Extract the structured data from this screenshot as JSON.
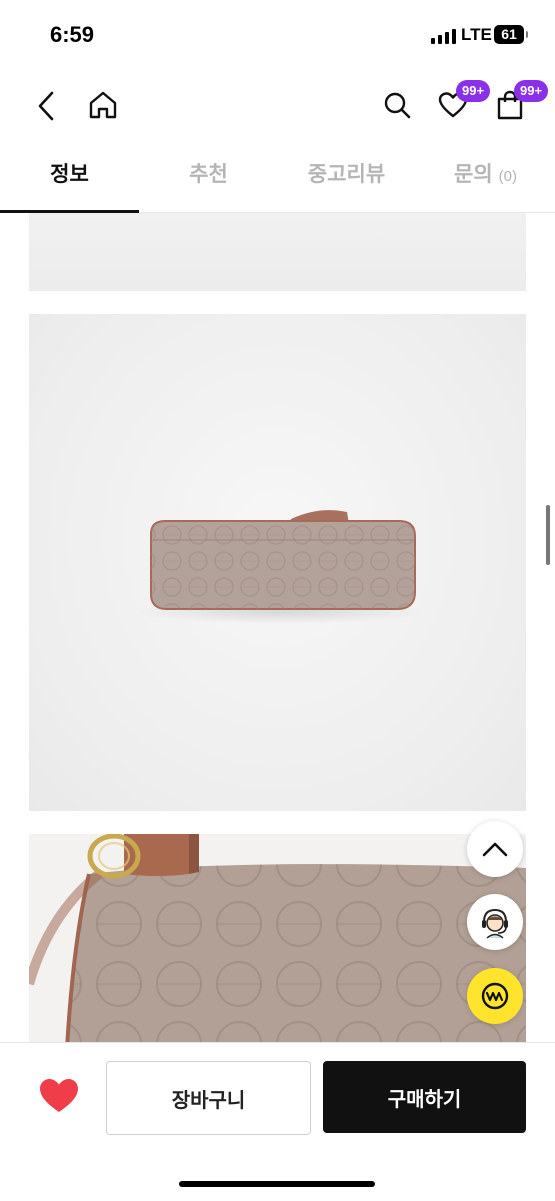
{
  "status_bar": {
    "time": "6:59",
    "network": "LTE",
    "battery": "61"
  },
  "header": {
    "wishlist_badge": "99+",
    "cart_badge": "99+"
  },
  "tabs": [
    {
      "label": "정보",
      "active": true
    },
    {
      "label": "추천",
      "active": false
    },
    {
      "label": "중고리뷰",
      "active": false
    },
    {
      "label": "문의",
      "count": "(0)",
      "active": false
    }
  ],
  "bottom_bar": {
    "cart_label": "장바구니",
    "buy_label": "구매하기"
  },
  "colors": {
    "badge": "#8a30e8",
    "heart": "#ef3e4a",
    "buy_button": "#111111",
    "chat_fab": "#ffe42b"
  },
  "icons": [
    "back-icon",
    "home-icon",
    "search-icon",
    "heart-icon",
    "shopping-bag-icon",
    "chevron-up-icon",
    "support-agent-icon",
    "won-chat-icon"
  ]
}
